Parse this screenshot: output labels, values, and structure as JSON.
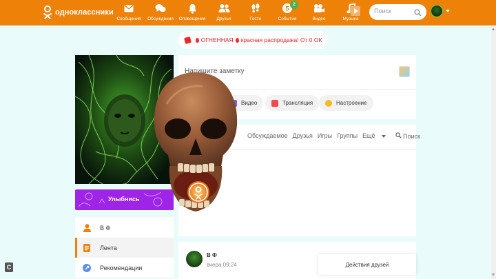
{
  "header": {
    "logo_text": "одноклассники",
    "nav": [
      {
        "label": "Сообщения",
        "icon": "envelope-icon"
      },
      {
        "label": "Обсуждения",
        "icon": "chat-bubbles-icon"
      },
      {
        "label": "Оповещения",
        "icon": "bell-icon"
      },
      {
        "label": "Друзья",
        "icon": "friends-icon"
      },
      {
        "label": "Гости",
        "icon": "footprints-icon"
      },
      {
        "label": "События",
        "icon": "events-icon",
        "badge": "2",
        "counter": "5"
      },
      {
        "label": "Видео",
        "icon": "video-camera-icon"
      },
      {
        "label": "Музыка",
        "icon": "music-note-icon"
      }
    ],
    "search_placeholder": "Поиск"
  },
  "promo": {
    "text_prefix": "ОГНЕННАЯ",
    "text_suffix": "красная распродажа! От 0 ОК"
  },
  "profile": {
    "smile_label": "Улыбнись"
  },
  "left_menu": [
    {
      "label": "В Ф",
      "icon": "user-icon",
      "active": false
    },
    {
      "label": "Лента",
      "icon": "feed-icon",
      "active": true
    },
    {
      "label": "Рекомендации",
      "icon": "recommendations-icon",
      "active": false
    }
  ],
  "composer": {
    "placeholder": "Напишите заметку",
    "actions": [
      {
        "label": "Видео",
        "icon": "video-icon"
      },
      {
        "label": "Трансляция",
        "icon": "broadcast-icon"
      },
      {
        "label": "Настроение",
        "icon": "mood-icon"
      }
    ]
  },
  "feed_tabs": [
    "Обсуждаемое",
    "Друзья",
    "Игры",
    "Группы",
    "Ещё"
  ],
  "feed_search_label": "Поиск",
  "post": {
    "author": "В Ф",
    "time": "вчера 09:24"
  },
  "friends_actions_label": "Действия друзей",
  "colors": {
    "brand": "#ee8208",
    "page_bg": "#e9fcfb",
    "smile_banner": "#9e24e8",
    "promo_text": "#dd2222"
  }
}
